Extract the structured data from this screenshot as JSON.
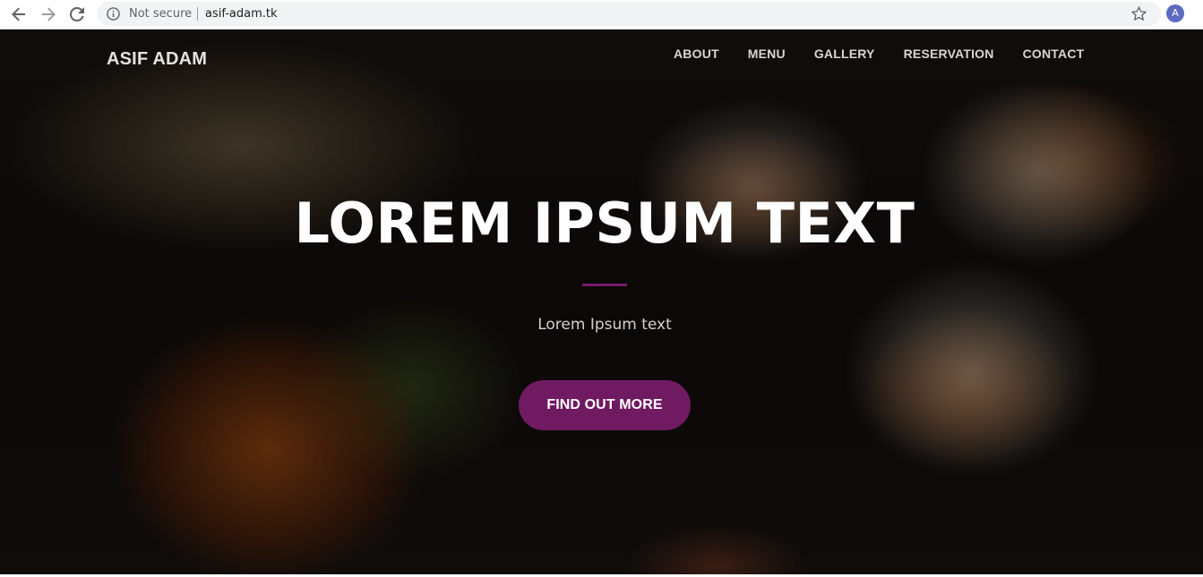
{
  "browser": {
    "security_label": "Not secure",
    "url": "asif-adam.tk",
    "profile_initial": "A"
  },
  "site": {
    "brand": "ASIF ADAM",
    "nav": [
      "ABOUT",
      "MENU",
      "GALLERY",
      "RESERVATION",
      "CONTACT"
    ]
  },
  "hero": {
    "title": "LOREM IPSUM TEXT",
    "subtitle": "Lorem Ipsum text",
    "cta_label": "FIND OUT MORE"
  },
  "colors": {
    "accent": "#701a62",
    "divider": "#7a1c6a",
    "avatar": "#5c6bc0"
  },
  "icons": {
    "back": "arrow-left-icon",
    "forward": "arrow-right-icon",
    "reload": "reload-icon",
    "info": "info-icon",
    "bookmark": "star-icon"
  }
}
